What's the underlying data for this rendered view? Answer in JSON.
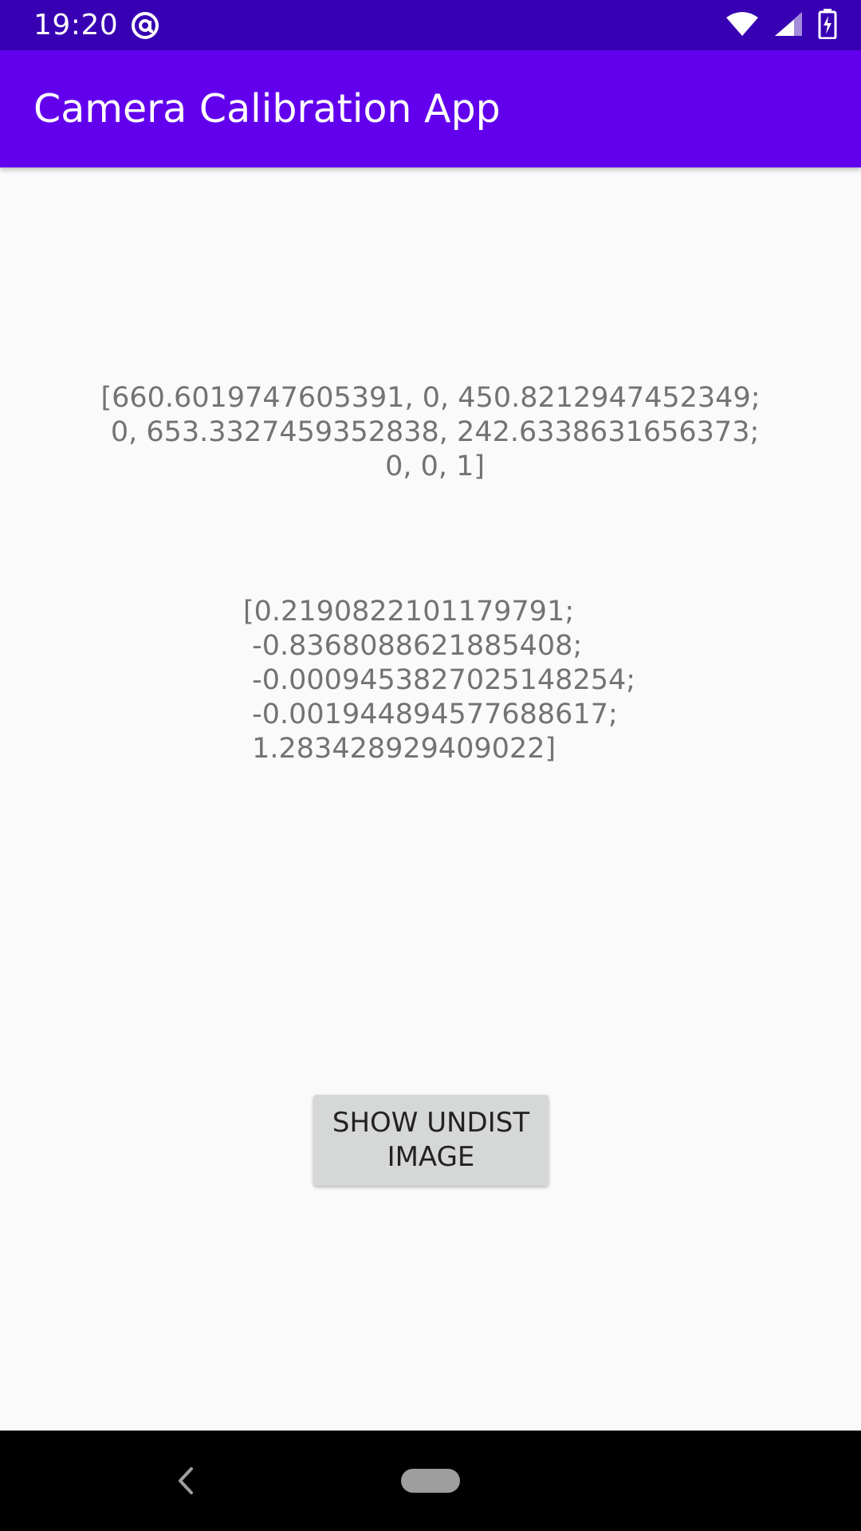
{
  "status_bar": {
    "time": "19:20",
    "icons": [
      "at-sign-icon",
      "wifi-icon",
      "cell-signal-icon",
      "battery-charging-icon"
    ],
    "background": "#3700b3"
  },
  "app_bar": {
    "title": "Camera Calibration App",
    "background": "#6200ee"
  },
  "main": {
    "camera_matrix_text": "[660.6019747605391, 0, 450.8212947452349;\n 0, 653.3327459352838, 242.6338631656373;\n 0, 0, 1]",
    "distortion_coeffs_text": "[0.2190822101179791;\n -0.8368088621885408;\n -0.0009453827025148254;\n -0.001944894577688617;\n 1.283428929409022]",
    "button_label": "SHOW UNDIST\nIMAGE"
  },
  "nav_bar": {
    "icons": [
      "back-icon",
      "home-pill-icon"
    ]
  }
}
